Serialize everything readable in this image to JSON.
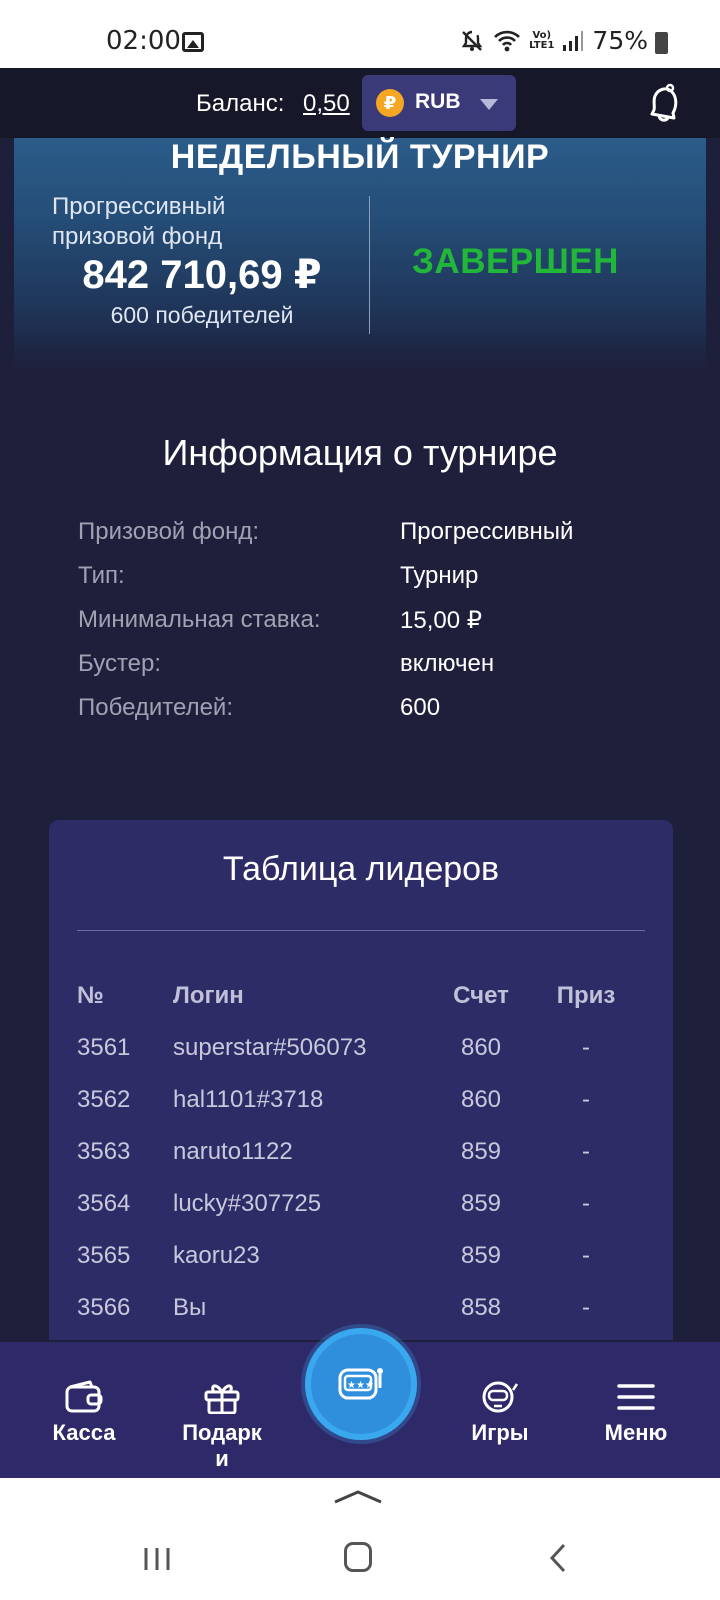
{
  "status_bar": {
    "time": "02:00",
    "lte_line1": "Vo)",
    "lte_line2": "LTE1",
    "battery": "75%",
    "icons": [
      "gallery-icon",
      "mute-icon",
      "wifi-icon",
      "signal-icon",
      "battery-icon"
    ]
  },
  "header": {
    "balance_label": "Баланс:",
    "balance_value": "0,50",
    "currency_symbol": "₽",
    "currency_code": "RUB"
  },
  "tournament": {
    "title": "НЕДЕЛЬНЫЙ ТУРНИР",
    "fund_label": "Прогрессивный призовой фонд",
    "fund_amount": "842 710,69 ₽",
    "winners": "600 победителей",
    "status": "ЗАВЕРШЕН",
    "status_color": "#21b83a"
  },
  "info": {
    "title": "Информация о турнире",
    "rows": [
      {
        "key": "Призовой фонд:",
        "value": "Прогрессивный"
      },
      {
        "key": "Тип:",
        "value": "Турнир"
      },
      {
        "key": "Минимальная ставка:",
        "value": "15,00 ₽"
      },
      {
        "key": "Бустер:",
        "value": "включен"
      },
      {
        "key": "Победителей:",
        "value": "600"
      }
    ]
  },
  "leaderboard": {
    "title": "Таблица лидеров",
    "columns": {
      "num": "№",
      "login": "Логин",
      "score": "Счет",
      "prize": "Приз"
    },
    "rows": [
      {
        "num": "3561",
        "login": "superstar#506073",
        "score": "860",
        "prize": "-"
      },
      {
        "num": "3562",
        "login": "hal1101#3718",
        "score": "860",
        "prize": "-"
      },
      {
        "num": "3563",
        "login": "naruto1122",
        "score": "859",
        "prize": "-"
      },
      {
        "num": "3564",
        "login": "lucky#307725",
        "score": "859",
        "prize": "-"
      },
      {
        "num": "3565",
        "login": "kaoru23",
        "score": "859",
        "prize": "-"
      },
      {
        "num": "3566",
        "login": "Вы",
        "score": "858",
        "prize": "-"
      }
    ]
  },
  "bottom_nav": {
    "cashier": "Касса",
    "gifts_line1": "Подарк",
    "gifts_line2": "и",
    "games": "Игры",
    "menu": "Меню",
    "accent": "#2f8fdc"
  }
}
